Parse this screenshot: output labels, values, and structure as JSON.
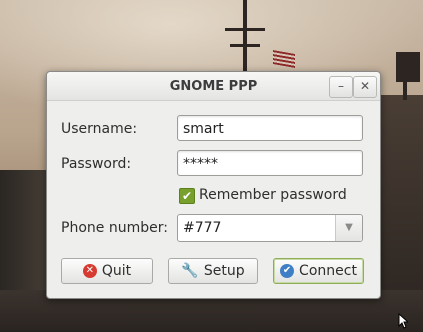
{
  "window": {
    "title": "GNOME PPP",
    "minimize_icon": "minimize-icon",
    "close_icon": "close-icon"
  },
  "form": {
    "username_label": "Username:",
    "username_value": "smart",
    "password_label": "Password:",
    "password_value": "*****",
    "remember_label": "Remember password",
    "remember_checked": true,
    "phone_label": "Phone number:",
    "phone_value": "#777"
  },
  "buttons": {
    "quit_label": "Quit",
    "setup_label": "Setup",
    "connect_label": "Connect"
  },
  "colors": {
    "checkbox": "#78a02d",
    "quit_icon": "#d63a31",
    "connect_icon": "#3f7fc6"
  }
}
